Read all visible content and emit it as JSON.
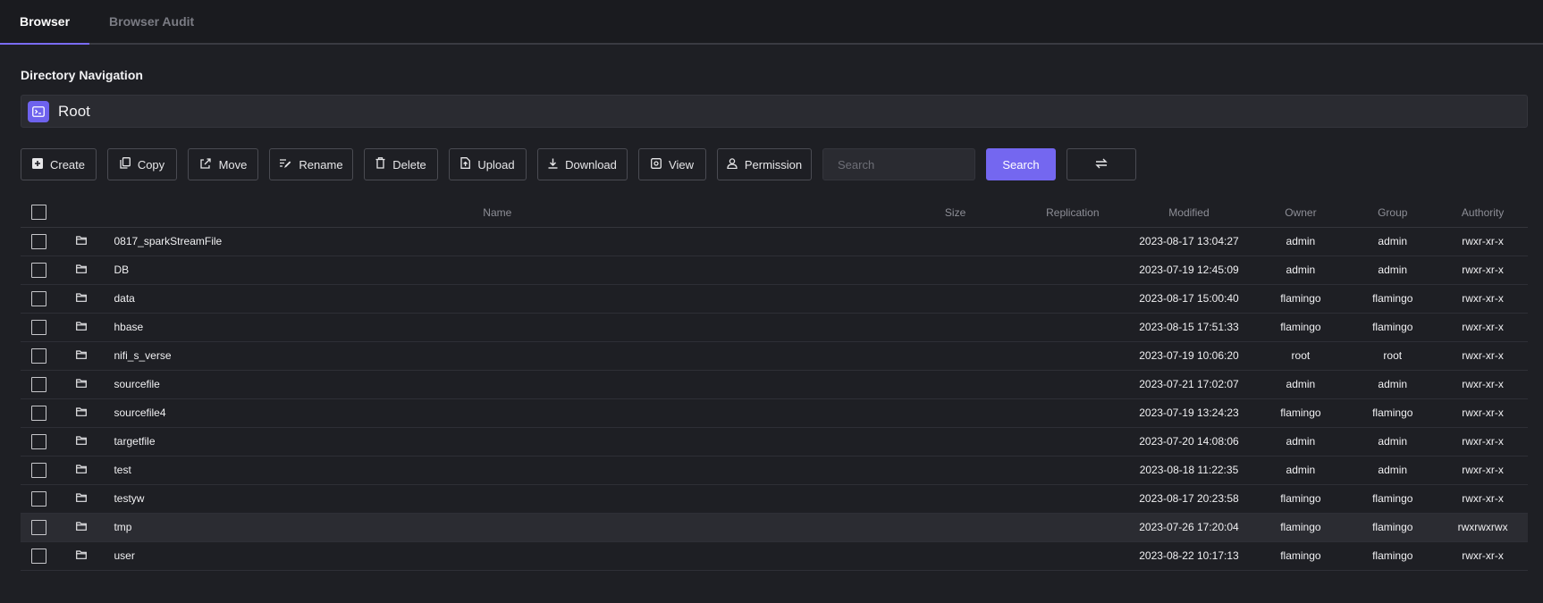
{
  "tabs": [
    {
      "label": "Browser",
      "active": true
    },
    {
      "label": "Browser Audit",
      "active": false
    }
  ],
  "section_title": "Directory Navigation",
  "path": {
    "label": "Root",
    "icon": "terminal-icon"
  },
  "toolbar": {
    "create": "Create",
    "copy": "Copy",
    "move": "Move",
    "rename": "Rename",
    "delete": "Delete",
    "upload": "Upload",
    "download": "Download",
    "view": "View",
    "permission": "Permission",
    "search_placeholder": "Search",
    "search_button": "Search",
    "refresh_icon": "swap-arrows-icon"
  },
  "colors": {
    "accent": "#7467f0",
    "background": "#1e1f24",
    "highlight_row": "#2b2c32"
  },
  "table": {
    "headers": {
      "name": "Name",
      "size": "Size",
      "replication": "Replication",
      "modified": "Modified",
      "owner": "Owner",
      "group": "Group",
      "authority": "Authority"
    },
    "rows": [
      {
        "name": "0817_sparkStreamFile",
        "size": "",
        "replication": "",
        "modified": "2023-08-17 13:04:27",
        "owner": "admin",
        "group": "admin",
        "authority": "rwxr-xr-x"
      },
      {
        "name": "DB",
        "size": "",
        "replication": "",
        "modified": "2023-07-19 12:45:09",
        "owner": "admin",
        "group": "admin",
        "authority": "rwxr-xr-x"
      },
      {
        "name": "data",
        "size": "",
        "replication": "",
        "modified": "2023-08-17 15:00:40",
        "owner": "flamingo",
        "group": "flamingo",
        "authority": "rwxr-xr-x"
      },
      {
        "name": "hbase",
        "size": "",
        "replication": "",
        "modified": "2023-08-15 17:51:33",
        "owner": "flamingo",
        "group": "flamingo",
        "authority": "rwxr-xr-x"
      },
      {
        "name": "nifi_s_verse",
        "size": "",
        "replication": "",
        "modified": "2023-07-19 10:06:20",
        "owner": "root",
        "group": "root",
        "authority": "rwxr-xr-x"
      },
      {
        "name": "sourcefile",
        "size": "",
        "replication": "",
        "modified": "2023-07-21 17:02:07",
        "owner": "admin",
        "group": "admin",
        "authority": "rwxr-xr-x"
      },
      {
        "name": "sourcefile4",
        "size": "",
        "replication": "",
        "modified": "2023-07-19 13:24:23",
        "owner": "flamingo",
        "group": "flamingo",
        "authority": "rwxr-xr-x"
      },
      {
        "name": "targetfile",
        "size": "",
        "replication": "",
        "modified": "2023-07-20 14:08:06",
        "owner": "admin",
        "group": "admin",
        "authority": "rwxr-xr-x"
      },
      {
        "name": "test",
        "size": "",
        "replication": "",
        "modified": "2023-08-18 11:22:35",
        "owner": "admin",
        "group": "admin",
        "authority": "rwxr-xr-x"
      },
      {
        "name": "testyw",
        "size": "",
        "replication": "",
        "modified": "2023-08-17 20:23:58",
        "owner": "flamingo",
        "group": "flamingo",
        "authority": "rwxr-xr-x"
      },
      {
        "name": "tmp",
        "size": "",
        "replication": "",
        "modified": "2023-07-26 17:20:04",
        "owner": "flamingo",
        "group": "flamingo",
        "authority": "rwxrwxrwx",
        "highlighted": true
      },
      {
        "name": "user",
        "size": "",
        "replication": "",
        "modified": "2023-08-22 10:17:13",
        "owner": "flamingo",
        "group": "flamingo",
        "authority": "rwxr-xr-x"
      }
    ]
  }
}
